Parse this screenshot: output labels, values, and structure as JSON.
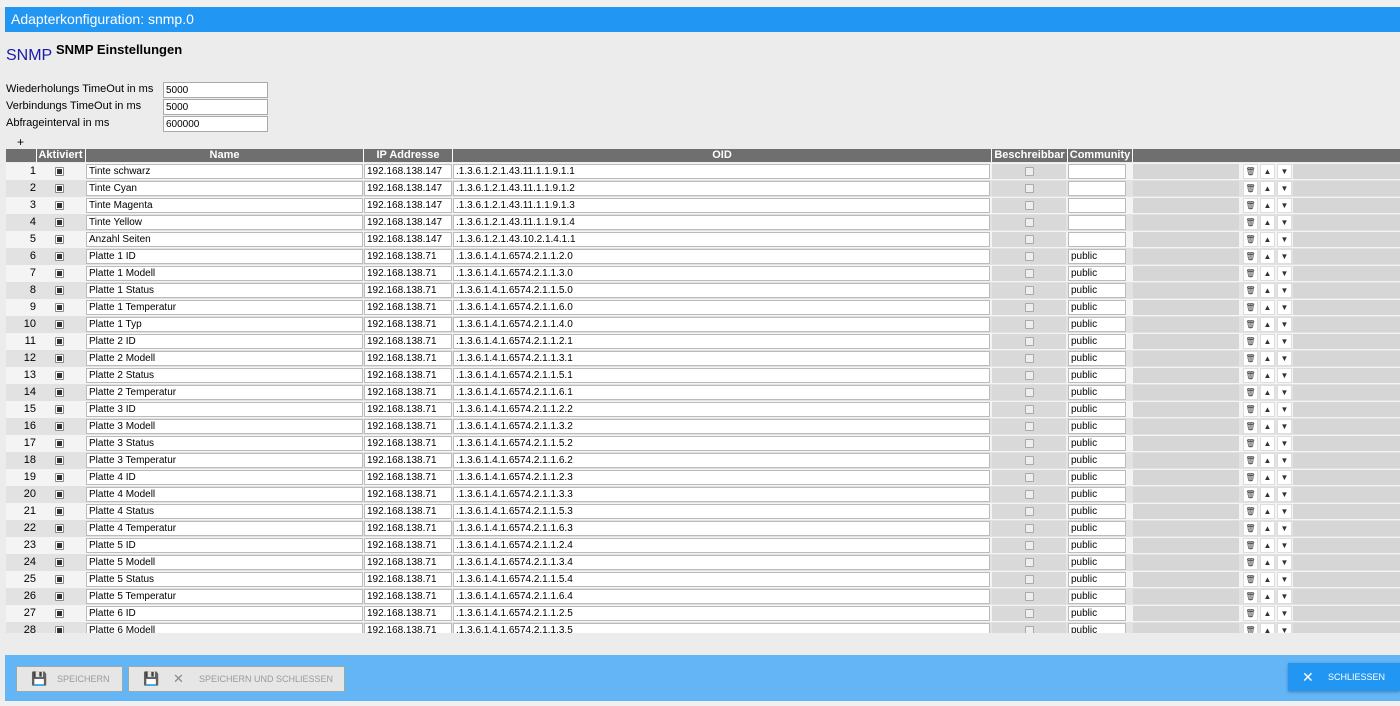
{
  "title": "Adapterkonfiguration: snmp.0",
  "logo_text": "SNMP",
  "settings_title": "SNMP Einstellungen",
  "fields": [
    {
      "label": "Wiederholungs TimeOut in ms",
      "value": "5000"
    },
    {
      "label": "Verbindungs TimeOut in ms",
      "value": "5000"
    },
    {
      "label": "Abfrageinterval in ms",
      "value": "600000"
    }
  ],
  "add_label": "+",
  "columns": {
    "aktiviert": "Aktiviert",
    "name": "Name",
    "ip": "IP Addresse",
    "oid": "OID",
    "beschreibbar": "Beschreibbar",
    "community": "Community"
  },
  "rows": [
    {
      "n": "1",
      "name": "Tinte schwarz",
      "ip": "192.168.138.147",
      "oid": ".1.3.6.1.2.1.43.11.1.1.9.1.1",
      "community": ""
    },
    {
      "n": "2",
      "name": "Tinte Cyan",
      "ip": "192.168.138.147",
      "oid": ".1.3.6.1.2.1.43.11.1.1.9.1.2",
      "community": ""
    },
    {
      "n": "3",
      "name": "Tinte Magenta",
      "ip": "192.168.138.147",
      "oid": ".1.3.6.1.2.1.43.11.1.1.9.1.3",
      "community": ""
    },
    {
      "n": "4",
      "name": "Tinte Yellow",
      "ip": "192.168.138.147",
      "oid": ".1.3.6.1.2.1.43.11.1.1.9.1.4",
      "community": ""
    },
    {
      "n": "5",
      "name": "Anzahl Seiten",
      "ip": "192.168.138.147",
      "oid": ".1.3.6.1.2.1.43.10.2.1.4.1.1",
      "community": ""
    },
    {
      "n": "6",
      "name": "Platte 1 ID",
      "ip": "192.168.138.71",
      "oid": ".1.3.6.1.4.1.6574.2.1.1.2.0",
      "community": "public"
    },
    {
      "n": "7",
      "name": "Platte 1 Modell",
      "ip": "192.168.138.71",
      "oid": ".1.3.6.1.4.1.6574.2.1.1.3.0",
      "community": "public"
    },
    {
      "n": "8",
      "name": "Platte 1 Status",
      "ip": "192.168.138.71",
      "oid": ".1.3.6.1.4.1.6574.2.1.1.5.0",
      "community": "public"
    },
    {
      "n": "9",
      "name": "Platte 1 Temperatur",
      "ip": "192.168.138.71",
      "oid": ".1.3.6.1.4.1.6574.2.1.1.6.0",
      "community": "public"
    },
    {
      "n": "10",
      "name": "Platte 1 Typ",
      "ip": "192.168.138.71",
      "oid": ".1.3.6.1.4.1.6574.2.1.1.4.0",
      "community": "public"
    },
    {
      "n": "11",
      "name": "Platte 2 ID",
      "ip": "192.168.138.71",
      "oid": ".1.3.6.1.4.1.6574.2.1.1.2.1",
      "community": "public"
    },
    {
      "n": "12",
      "name": "Platte 2 Modell",
      "ip": "192.168.138.71",
      "oid": ".1.3.6.1.4.1.6574.2.1.1.3.1",
      "community": "public"
    },
    {
      "n": "13",
      "name": "Platte 2 Status",
      "ip": "192.168.138.71",
      "oid": ".1.3.6.1.4.1.6574.2.1.1.5.1",
      "community": "public"
    },
    {
      "n": "14",
      "name": "Platte 2 Temperatur",
      "ip": "192.168.138.71",
      "oid": ".1.3.6.1.4.1.6574.2.1.1.6.1",
      "community": "public"
    },
    {
      "n": "15",
      "name": "Platte 3 ID",
      "ip": "192.168.138.71",
      "oid": ".1.3.6.1.4.1.6574.2.1.1.2.2",
      "community": "public"
    },
    {
      "n": "16",
      "name": "Platte 3 Modell",
      "ip": "192.168.138.71",
      "oid": ".1.3.6.1.4.1.6574.2.1.1.3.2",
      "community": "public"
    },
    {
      "n": "17",
      "name": "Platte 3 Status",
      "ip": "192.168.138.71",
      "oid": ".1.3.6.1.4.1.6574.2.1.1.5.2",
      "community": "public"
    },
    {
      "n": "18",
      "name": "Platte 3 Temperatur",
      "ip": "192.168.138.71",
      "oid": ".1.3.6.1.4.1.6574.2.1.1.6.2",
      "community": "public"
    },
    {
      "n": "19",
      "name": "Platte 4 ID",
      "ip": "192.168.138.71",
      "oid": ".1.3.6.1.4.1.6574.2.1.1.2.3",
      "community": "public"
    },
    {
      "n": "20",
      "name": "Platte 4 Modell",
      "ip": "192.168.138.71",
      "oid": ".1.3.6.1.4.1.6574.2.1.1.3.3",
      "community": "public"
    },
    {
      "n": "21",
      "name": "Platte 4 Status",
      "ip": "192.168.138.71",
      "oid": ".1.3.6.1.4.1.6574.2.1.1.5.3",
      "community": "public"
    },
    {
      "n": "22",
      "name": "Platte 4 Temperatur",
      "ip": "192.168.138.71",
      "oid": ".1.3.6.1.4.1.6574.2.1.1.6.3",
      "community": "public"
    },
    {
      "n": "23",
      "name": "Platte 5 ID",
      "ip": "192.168.138.71",
      "oid": ".1.3.6.1.4.1.6574.2.1.1.2.4",
      "community": "public"
    },
    {
      "n": "24",
      "name": "Platte 5 Modell",
      "ip": "192.168.138.71",
      "oid": ".1.3.6.1.4.1.6574.2.1.1.3.4",
      "community": "public"
    },
    {
      "n": "25",
      "name": "Platte 5 Status",
      "ip": "192.168.138.71",
      "oid": ".1.3.6.1.4.1.6574.2.1.1.5.4",
      "community": "public"
    },
    {
      "n": "26",
      "name": "Platte 5 Temperatur",
      "ip": "192.168.138.71",
      "oid": ".1.3.6.1.4.1.6574.2.1.1.6.4",
      "community": "public"
    },
    {
      "n": "27",
      "name": "Platte 6 ID",
      "ip": "192.168.138.71",
      "oid": ".1.3.6.1.4.1.6574.2.1.1.2.5",
      "community": "public"
    },
    {
      "n": "28",
      "name": "Platte 6 Modell",
      "ip": "192.168.138.71",
      "oid": ".1.3.6.1.4.1.6574.2.1.1.3.5",
      "community": "public"
    }
  ],
  "row_icons": {
    "delete": "trash-icon",
    "up": "arrow-up-icon",
    "down": "arrow-down-icon"
  },
  "footer": {
    "save": "Speichern",
    "save_close": "Speichern und schliessen",
    "close": "Schliessen"
  },
  "colors": {
    "accent": "#2196f3",
    "footer": "#64b5f6",
    "header_bg": "#6f6f6f"
  }
}
